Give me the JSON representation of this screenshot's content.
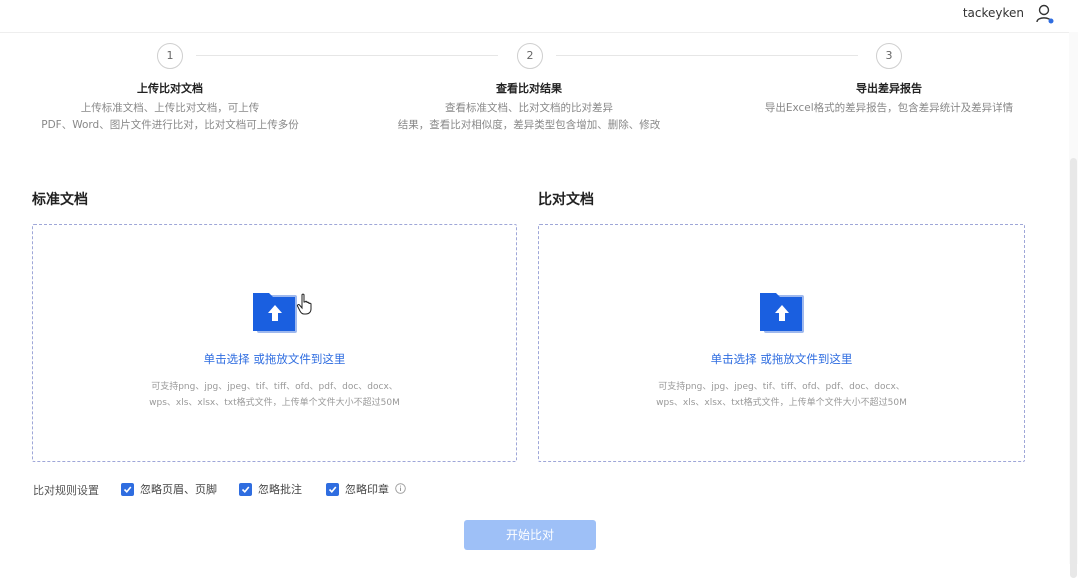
{
  "header": {
    "username": "tackeyken",
    "user_icon": "user-icon"
  },
  "steps": [
    {
      "number": "1",
      "title": "上传比对文档",
      "desc_line1": "上传标准文档、上传比对文档，可上传",
      "desc_line2": "PDF、Word、图片文件进行比对，比对文档可上传多份"
    },
    {
      "number": "2",
      "title": "查看比对结果",
      "desc_line1": "查看标准文档、比对文档的比对差异",
      "desc_line2": "结果，查看比对相似度，差异类型包含增加、删除、修改"
    },
    {
      "number": "3",
      "title": "导出差异报告",
      "desc_line1": "导出Excel格式的差异报告，包含差异统计及差异详情",
      "desc_line2": ""
    }
  ],
  "standard_doc": {
    "title": "标准文档",
    "prompt": "单击选择 或拖放文件到这里",
    "hint_line1": "可支持png、jpg、jpeg、tif、tiff、ofd、pdf、doc、docx、",
    "hint_line2": "wps、xls、xlsx、txt格式文件，上传单个文件大小不超过50M"
  },
  "compare_doc": {
    "title": "比对文档",
    "prompt": "单击选择 或拖放文件到这里",
    "hint_line1": "可支持png、jpg、jpeg、tif、tiff、ofd、pdf、doc、docx、",
    "hint_line2": "wps、xls、xlsx、txt格式文件，上传单个文件大小不超过50M"
  },
  "rules": {
    "label": "比对规则设置",
    "options": [
      {
        "label": "忽略页眉、页脚",
        "checked": true
      },
      {
        "label": "忽略批注",
        "checked": true
      },
      {
        "label": "忽略印章",
        "checked": true
      }
    ]
  },
  "start_button": "开始比对",
  "colors": {
    "accent": "#2f6de0",
    "button_disabled": "#9ec0f7",
    "border_dashed": "#9fa7d8"
  }
}
